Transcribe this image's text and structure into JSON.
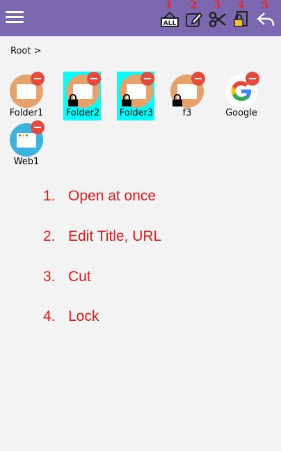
{
  "toolbar": {
    "menu_icon": "hamburger-menu-icon",
    "buttons": [
      {
        "number": "1",
        "icon": "open-all-icon",
        "badge_text": "ALL"
      },
      {
        "number": "2",
        "icon": "edit-icon"
      },
      {
        "number": "3",
        "icon": "scissors-icon"
      },
      {
        "number": "4",
        "icon": "lock-icon"
      },
      {
        "number": "5",
        "icon": "reply-back-icon"
      }
    ],
    "colors": {
      "bar": "#7b68b0",
      "numbers": "#e8261e"
    }
  },
  "breadcrumb": "Root >",
  "items": [
    {
      "label": "Folder1",
      "type": "folder",
      "selected": false,
      "locked": false
    },
    {
      "label": "Folder2",
      "type": "folder",
      "selected": true,
      "locked": true
    },
    {
      "label": "Folder3",
      "type": "folder",
      "selected": true,
      "locked": true
    },
    {
      "label": "f3",
      "type": "folder",
      "selected": false,
      "locked": true
    },
    {
      "label": "Google",
      "type": "google",
      "selected": false,
      "locked": false
    },
    {
      "label": "Web1",
      "type": "web",
      "selected": false,
      "locked": false
    }
  ],
  "legend": [
    {
      "number": "1.",
      "text": "Open at once"
    },
    {
      "number": "2.",
      "text": "Edit Title, URL"
    },
    {
      "number": "3.",
      "text": "Cut"
    },
    {
      "number": "4.",
      "text": "Lock"
    }
  ],
  "colors": {
    "selection": "#00ffff",
    "folder": "#e6a26a",
    "web": "#3bb3dc",
    "remove": "#e64a3c",
    "legend_text": "#e01b1b"
  }
}
